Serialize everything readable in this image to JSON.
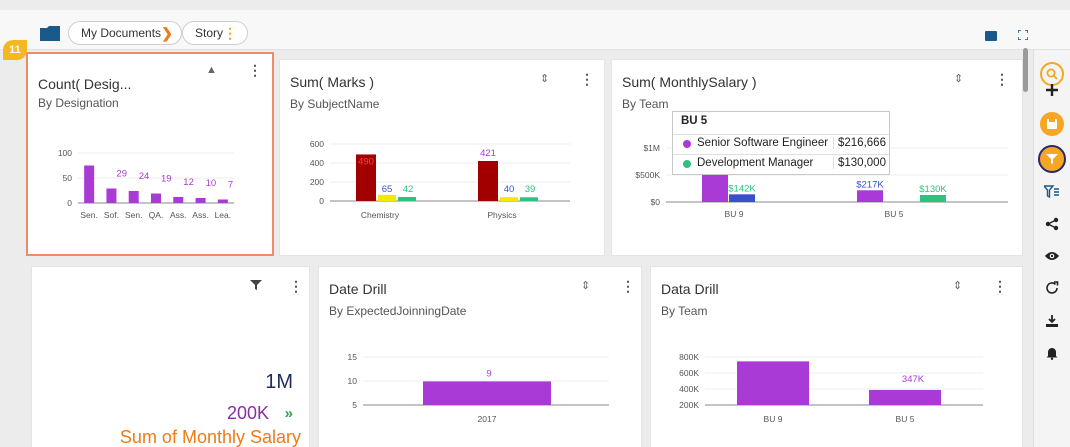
{
  "breadcrumb": {
    "item1": "My Documents",
    "item2": "Story"
  },
  "badge": "11",
  "cards": {
    "designation": {
      "title": "Count( Desig...",
      "subtitle": "By Designation"
    },
    "marks": {
      "title": "Sum( Marks )",
      "subtitle": "By SubjectName"
    },
    "salary": {
      "title": "Sum( MonthlySalary )",
      "subtitle": "By Team"
    },
    "kpi": {
      "value": "1M",
      "sub_value": "200K",
      "label": "Sum of Monthly Salary"
    },
    "date_drill": {
      "title": "Date Drill",
      "subtitle": "By ExpectedJoinningDate"
    },
    "data_drill": {
      "title": "Data Drill",
      "subtitle": "By Team"
    }
  },
  "tooltip": {
    "header": "BU 5",
    "rows": [
      {
        "name": "Senior Software Engineer",
        "value": "$216,666",
        "color": "#a93ad6"
      },
      {
        "name": "Development Manager",
        "value": "$130,000",
        "color": "#2ec27e"
      }
    ]
  },
  "icons": {
    "top": [
      "folder-icon",
      "comment-icon",
      "expand-icon"
    ],
    "sidebar": [
      "search-icon",
      "add-icon",
      "save-icon",
      "filter-icon",
      "filter-list-icon",
      "share-icon",
      "view-icon",
      "refresh-icon",
      "export-icon",
      "notification-icon"
    ]
  },
  "colors": {
    "purple": "#a93ad6",
    "darkred": "#a20000",
    "yellow": "#f5e800",
    "green": "#2ec27e",
    "blue": "#3a4fcf",
    "orange": "#f07b14",
    "accent": "#f5a623"
  },
  "chart_data": [
    {
      "type": "bar",
      "title": "Count( Desig...",
      "subtitle": "By Designation",
      "categories": [
        "Sen.",
        "Sof.",
        "Sen.",
        "QA.",
        "Ass.",
        "Ass.",
        "Lea."
      ],
      "values": [
        75,
        29,
        24,
        19,
        12,
        10,
        7
      ],
      "labels": [
        "",
        "29",
        "24",
        "19",
        "12",
        "10",
        "7"
      ],
      "ylim": [
        0,
        100
      ],
      "yticks": [
        "100",
        "50",
        "0"
      ]
    },
    {
      "type": "bar",
      "title": "Sum( Marks )",
      "subtitle": "By SubjectName",
      "categories": [
        "Chemistry",
        "Physics"
      ],
      "series": [
        {
          "color": "#a20000",
          "values": [
            490,
            421
          ],
          "labels": [
            "490",
            "421"
          ]
        },
        {
          "color": "#f5e800",
          "values": [
            65,
            40
          ],
          "labels": [
            "",
            ""
          ]
        },
        {
          "color": "#2ec27e",
          "values": [
            42,
            39
          ],
          "labels": [
            "42",
            "39"
          ]
        }
      ],
      "extra_labels": [
        "65",
        "40"
      ],
      "ylim": [
        0,
        600
      ],
      "yticks": [
        "600",
        "400",
        "200",
        "0"
      ]
    },
    {
      "type": "bar",
      "title": "Sum( MonthlySalary )",
      "subtitle": "By Team",
      "categories": [
        "BU 9",
        "BU 5"
      ],
      "series": [
        {
          "color": "#a93ad6",
          "values": [
            560000,
            216666
          ],
          "labels": [
            "",
            "$217K"
          ]
        },
        {
          "color": "#3a4fcf",
          "values": [
            142000,
            0
          ],
          "labels": [
            "$142K",
            ""
          ]
        },
        {
          "color": "#2ec27e",
          "values": [
            0,
            130000
          ],
          "labels": [
            "",
            "$130K"
          ]
        }
      ],
      "ylim": [
        0,
        1000000
      ],
      "yticks": [
        "$1M",
        "$500K",
        "$0"
      ]
    },
    {
      "type": "bar",
      "title": "Date Drill",
      "subtitle": "By ExpectedJoinningDate",
      "categories": [
        "2017"
      ],
      "values": [
        9
      ],
      "labels": [
        "9"
      ],
      "ylim": [
        0,
        15
      ],
      "yticks": [
        "15",
        "10",
        "5"
      ]
    },
    {
      "type": "bar",
      "title": "Data Drill",
      "subtitle": "By Team",
      "categories": [
        "BU 9",
        "BU 5"
      ],
      "values": [
        740000,
        347000
      ],
      "labels": [
        "",
        "347K"
      ],
      "ylim": [
        0,
        800000
      ],
      "yticks": [
        "800K",
        "600K",
        "400K",
        "200K"
      ]
    }
  ]
}
